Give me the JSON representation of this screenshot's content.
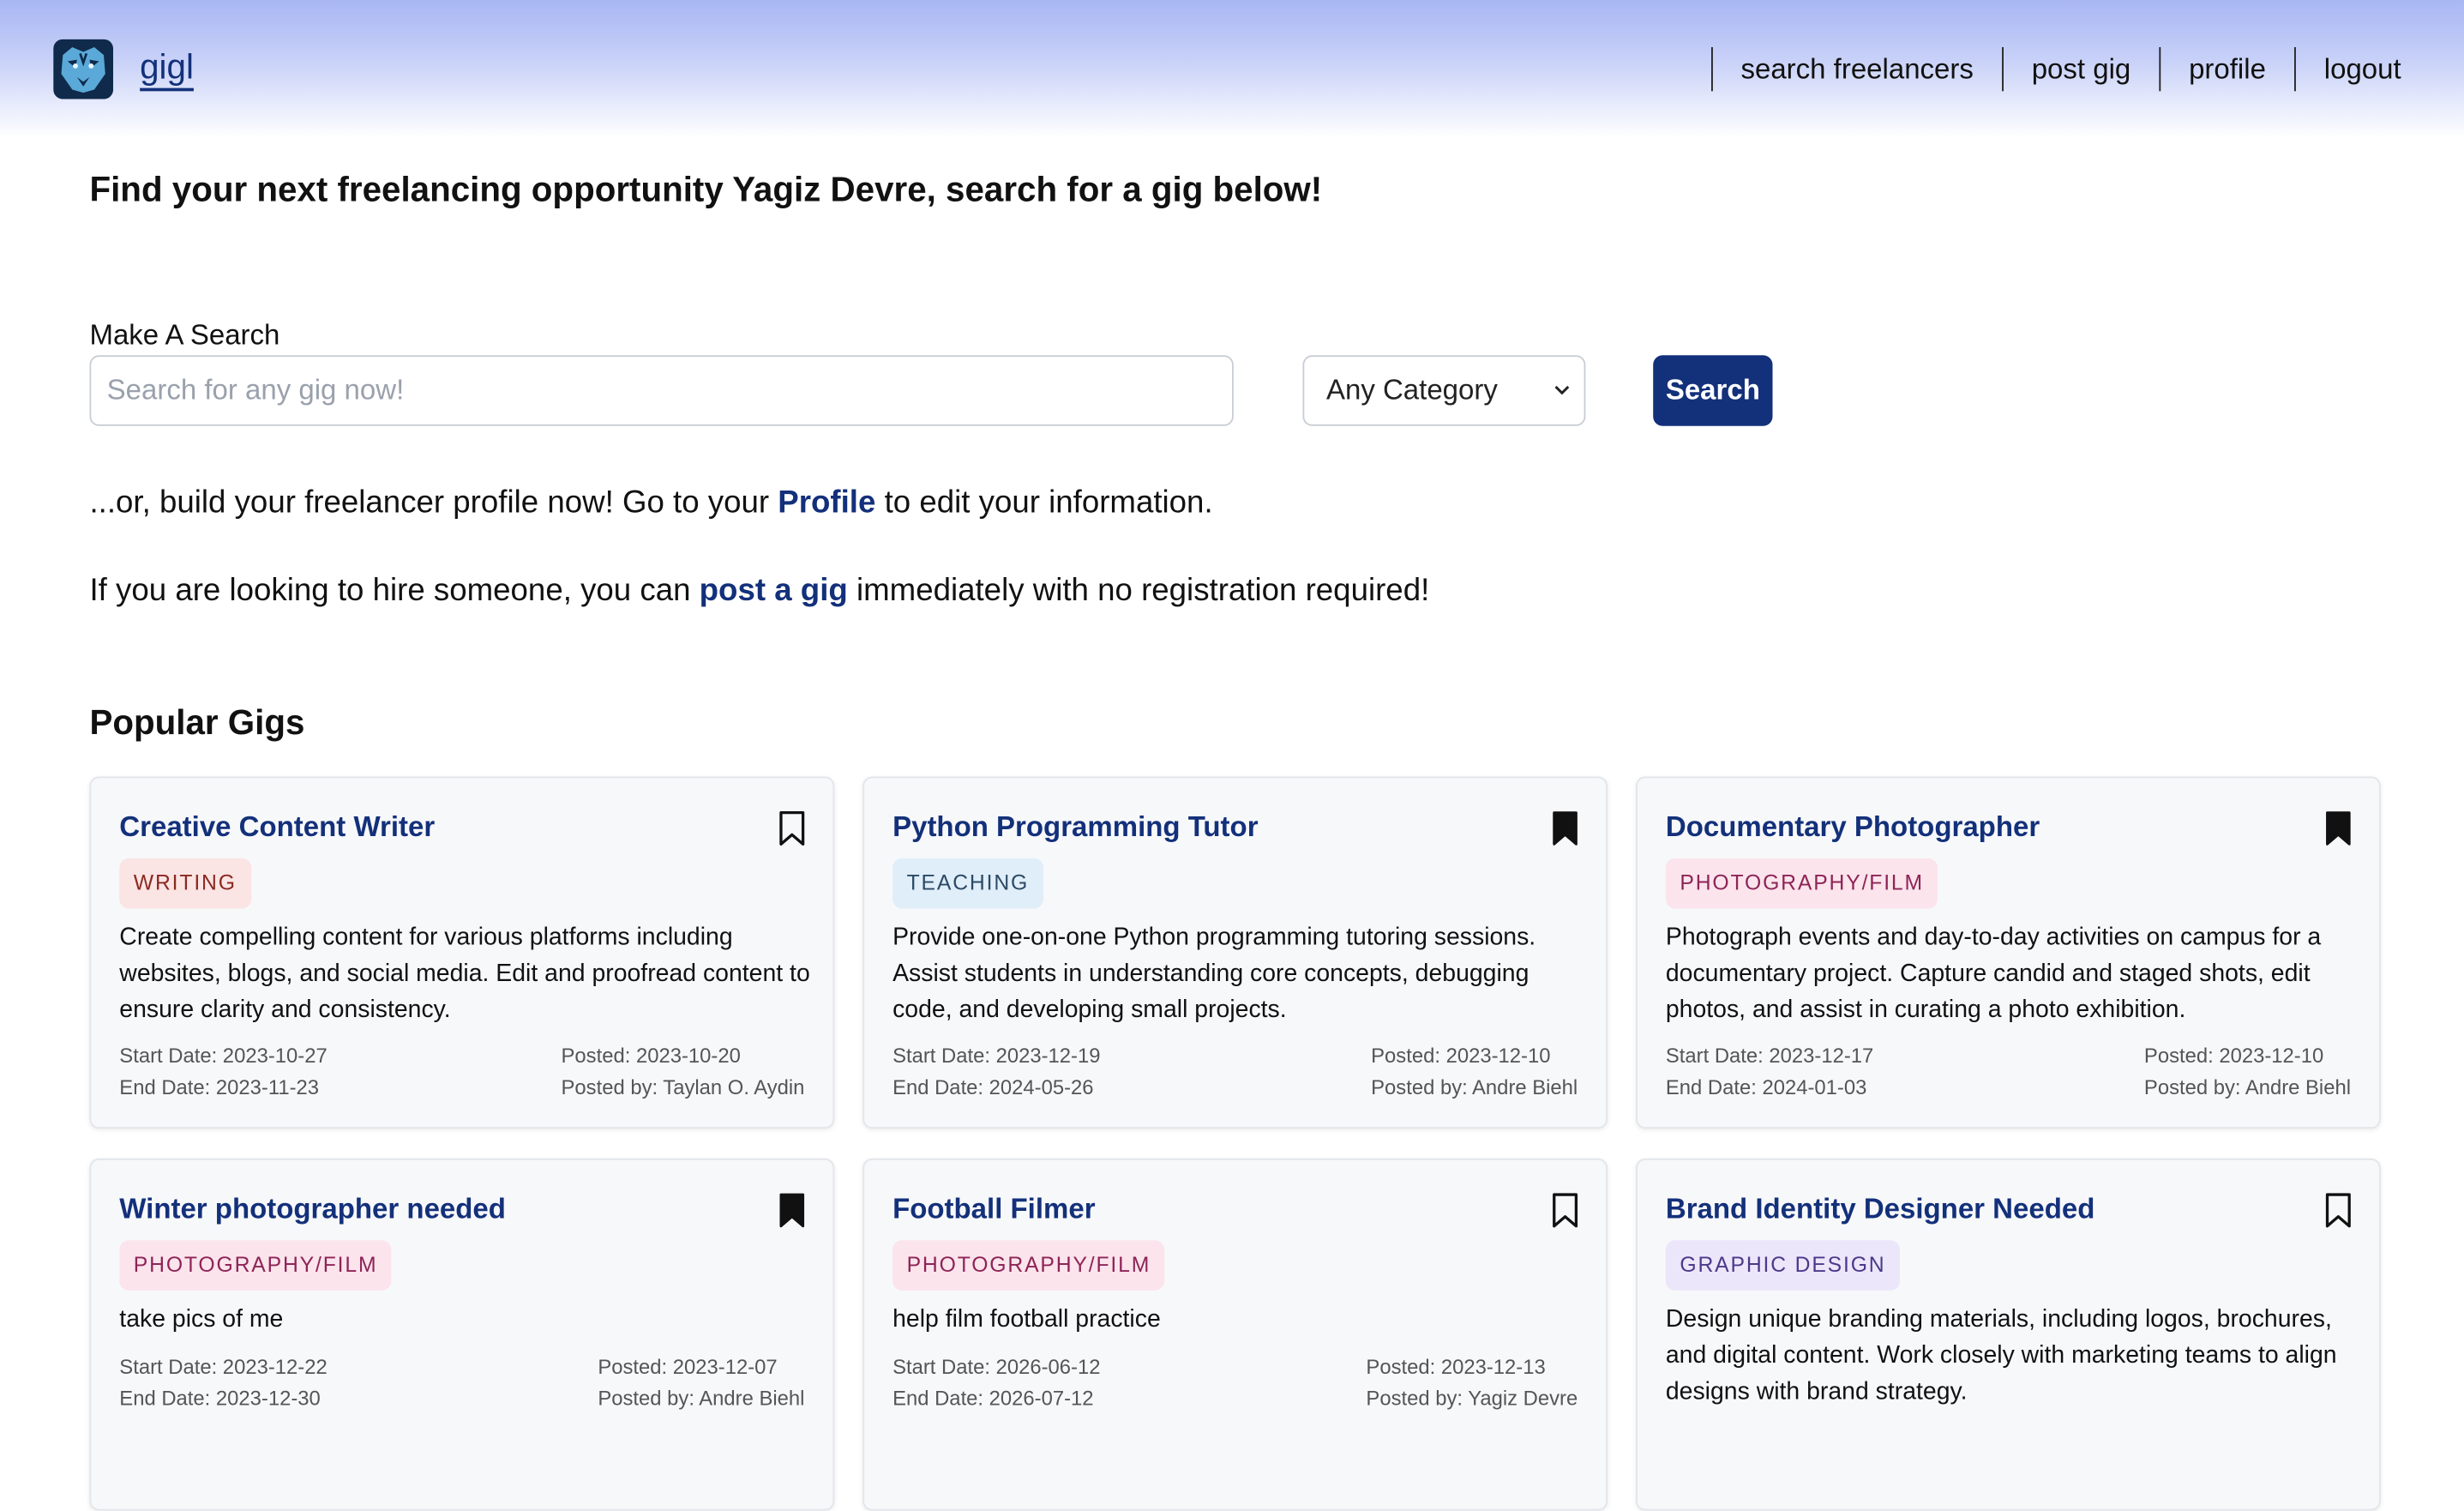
{
  "header": {
    "brand": "gigl",
    "nav": [
      "search freelancers",
      "post gig",
      "profile",
      "logout"
    ]
  },
  "main": {
    "headline": "Find your next freelancing opportunity Yagiz Devre, search for a gig below!",
    "search_label": "Make A Search",
    "search_placeholder": "Search for any gig now!",
    "category_value": "Any Category",
    "search_button": "Search",
    "profile_line": {
      "before": "...or, build your freelancer profile now! Go to your ",
      "link": "Profile",
      "after": " to edit your information."
    },
    "hire_line": {
      "before": "If you are looking to hire someone, you can ",
      "link": "post a gig",
      "after": " immediately with no registration required!"
    },
    "popular_title": "Popular Gigs"
  },
  "gigs": [
    {
      "title": "Creative Content Writer",
      "tag": "WRITING",
      "tag_class": "writing",
      "bookmarked": false,
      "desc": "Create compelling content for various platforms including websites, blogs, and social media. Edit and proofread content to ensure clarity and consistency.",
      "start": "Start Date: 2023-10-27",
      "end": "End Date: 2023-11-23",
      "posted": "Posted: 2023-10-20",
      "posted_by": "Posted by: Taylan O. Aydin"
    },
    {
      "title": "Python Programming Tutor",
      "tag": "TEACHING",
      "tag_class": "teaching",
      "bookmarked": true,
      "desc": "Provide one-on-one Python programming tutoring sessions. Assist students in understanding core concepts, debugging code, and developing small projects.",
      "start": "Start Date: 2023-12-19",
      "end": "End Date: 2024-05-26",
      "posted": "Posted: 2023-12-10",
      "posted_by": "Posted by: Andre Biehl"
    },
    {
      "title": "Documentary Photographer",
      "tag": "PHOTOGRAPHY/FILM",
      "tag_class": "photo",
      "bookmarked": true,
      "desc": "Photograph events and day-to-day activities on campus for a documentary project. Capture candid and staged shots, edit photos, and assist in curating a photo exhibition.",
      "start": "Start Date: 2023-12-17",
      "end": "End Date: 2024-01-03",
      "posted": "Posted: 2023-12-10",
      "posted_by": "Posted by: Andre Biehl"
    },
    {
      "title": "Winter photographer needed",
      "tag": "PHOTOGRAPHY/FILM",
      "tag_class": "photo",
      "bookmarked": true,
      "desc": "take pics of me",
      "start": "Start Date: 2023-12-22",
      "end": "End Date: 2023-12-30",
      "posted": "Posted: 2023-12-07",
      "posted_by": "Posted by: Andre Biehl"
    },
    {
      "title": "Football Filmer",
      "tag": "PHOTOGRAPHY/FILM",
      "tag_class": "photo",
      "bookmarked": false,
      "desc": "help film football practice",
      "start": "Start Date: 2026-06-12",
      "end": "End Date: 2026-07-12",
      "posted": "Posted: 2023-12-13",
      "posted_by": "Posted by: Yagiz Devre"
    },
    {
      "title": "Brand Identity Designer Needed",
      "tag": "GRAPHIC DESIGN",
      "tag_class": "design",
      "bookmarked": false,
      "desc": "Design unique branding materials, including logos, brochures, and digital content. Work closely with marketing teams to align designs with brand strategy.",
      "start": "",
      "end": "",
      "posted": "",
      "posted_by": ""
    }
  ],
  "colors": {
    "brand_navy": "#13307a",
    "header_gradient_top": "#a8b6f3"
  }
}
